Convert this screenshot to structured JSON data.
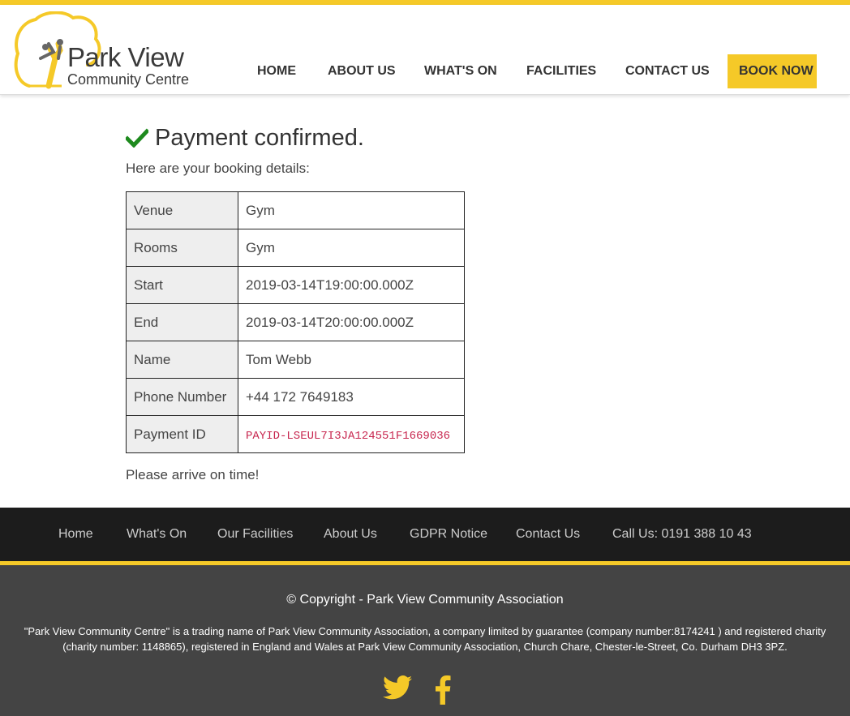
{
  "brand": {
    "name_line1": "Park View",
    "name_line2": "Community Centre",
    "accent_color": "#f5c928"
  },
  "nav": {
    "home": "HOME",
    "about": "ABOUT US",
    "whats_on": "WHAT'S ON",
    "facilities": "FACILITIES",
    "contact": "CONTACT US",
    "book_now": "BOOK NOW"
  },
  "confirmation": {
    "title": "Payment confirmed.",
    "intro": "Here are your booking details:",
    "icon": "check-icon",
    "rows": [
      {
        "label": "Venue",
        "value": "Gym"
      },
      {
        "label": "Rooms",
        "value": "Gym"
      },
      {
        "label": "Start",
        "value": "2019-03-14T19:00:00.000Z"
      },
      {
        "label": "End",
        "value": "2019-03-14T20:00:00.000Z"
      },
      {
        "label": "Name",
        "value": "Tom Webb"
      },
      {
        "label": "Phone Number",
        "value": "+44 172 7649183"
      },
      {
        "label": "Payment ID",
        "value": "PAYID-LSEUL7I3JA124551F1669036"
      }
    ],
    "note": "Please arrive on time!"
  },
  "footer": {
    "links": [
      "Home",
      "What's On",
      "Our Facilities",
      "About Us",
      "GDPR Notice",
      "Contact Us",
      "Call Us: 0191 388 10 43"
    ],
    "copyright": "© Copyright - Park View Community Association",
    "legal": "\"Park View Community Centre\" is a trading name of Park View Community Association, a company limited by guarantee (company number:8174241 ) and registered charity (charity number: 1148865), registered in England and Wales at Park View Community Association, Church Chare, Chester-le-Street, Co. Durham DH3 3PZ.",
    "social": [
      "twitter-icon",
      "facebook-icon"
    ]
  }
}
